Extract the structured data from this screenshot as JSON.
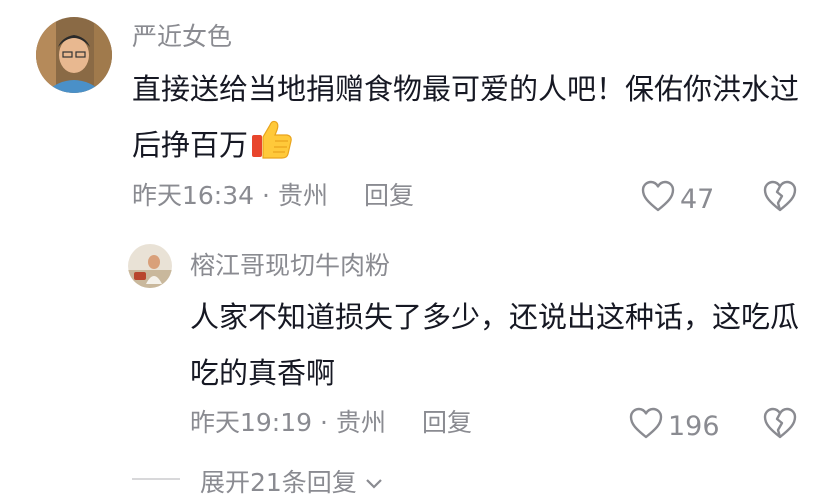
{
  "comments": [
    {
      "username": "严近女色",
      "text": "直接送给当地捐赠食物最可爱的人吧！保佑你洪水过后挣百万",
      "emoji": "thumbs-up",
      "time": "昨天16:34",
      "separator": "·",
      "location": "贵州",
      "reply_label": "回复",
      "likes": "47"
    },
    {
      "username": "榕江哥现切牛肉粉",
      "text": "人家不知道损失了多少，还说出这种话，这吃瓜吃的真香啊",
      "time": "昨天19:19",
      "separator": "·",
      "location": "贵州",
      "reply_label": "回复",
      "likes": "196"
    }
  ],
  "expand_replies_label": "展开21条回复",
  "colors": {
    "primary_text": "#161823",
    "secondary_text": "#8a8b91"
  }
}
